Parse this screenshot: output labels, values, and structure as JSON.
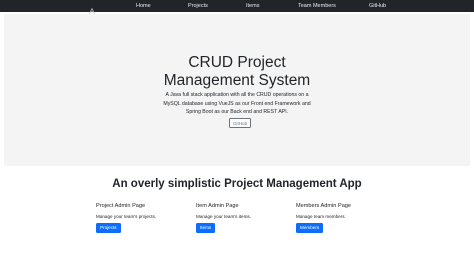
{
  "nav": {
    "brand_icon": "app-logo-icon",
    "links": [
      "Home",
      "Projects",
      "Items",
      "Team Members",
      "GitHub"
    ]
  },
  "hero": {
    "title_lines": [
      "CRUD Project",
      "Management System"
    ],
    "description_lines": [
      "A Java full stack application with all the CRUD operations on a",
      "MySQL database using VueJS as our Front end Framework and",
      "Spring Boot as our Back end and REST API."
    ],
    "github_button": "GitHub"
  },
  "section": {
    "title": "An overly simplistic Project Management App"
  },
  "cards": [
    {
      "title": "Project Admin Page",
      "text": "Manage your team's projects.",
      "button": "Projects"
    },
    {
      "title": "Item Admin Page",
      "text": "Manage your team's items.",
      "button": "Items"
    },
    {
      "title": "Members Admin Page",
      "text": "Manage team members.",
      "button": "Members"
    }
  ],
  "colors": {
    "navbar": "#212529",
    "jumbotron": "#f4f4f5",
    "primary": "#0d6efd",
    "secondary": "#6c757d"
  }
}
